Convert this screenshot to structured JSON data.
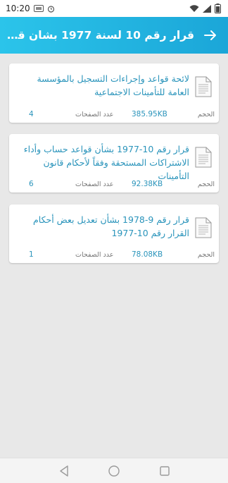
{
  "status_bar": {
    "time": "10:20",
    "icons": [
      "sim-icon",
      "alarm-icon",
      "wifi-icon",
      "signal-icon",
      "battery-icon"
    ]
  },
  "header": {
    "title": "قرار رقم 10 لسنة 1977 بشان قواعد...",
    "back_icon": "arrow-right-icon",
    "colors": {
      "start": "#2bc4ea",
      "end": "#1ba6d8"
    }
  },
  "documents": [
    {
      "title": "لائحة قواعد وإجراءات التسجيل بالمؤسسة العامة للتأمينات الاجتماعية",
      "size_label": "الحجم",
      "size_value": "385.95KB",
      "pages_label": "عدد الصفحات",
      "pages_value": "4"
    },
    {
      "title": "قرار رقم 10-1977 بشأن قواعد حساب وأداء الاشتراكات المستحقة وفقاً لأحكام قانون التأمينات",
      "size_label": "الحجم",
      "size_value": "92.38KB",
      "pages_label": "عدد الصفحات",
      "pages_value": "6"
    },
    {
      "title": "قرار رقم 9-1978 بشأن تعديل بعض أحكام القرار رقم 10-1977",
      "size_label": "الحجم",
      "size_value": "78.08KB",
      "pages_label": "عدد الصفحات",
      "pages_value": "1"
    }
  ],
  "nav_bar": {
    "icons": [
      "back-triangle-icon",
      "home-circle-icon",
      "recents-square-icon"
    ]
  },
  "colors": {
    "accent": "#2a94bb",
    "background": "#e8e8e8"
  }
}
